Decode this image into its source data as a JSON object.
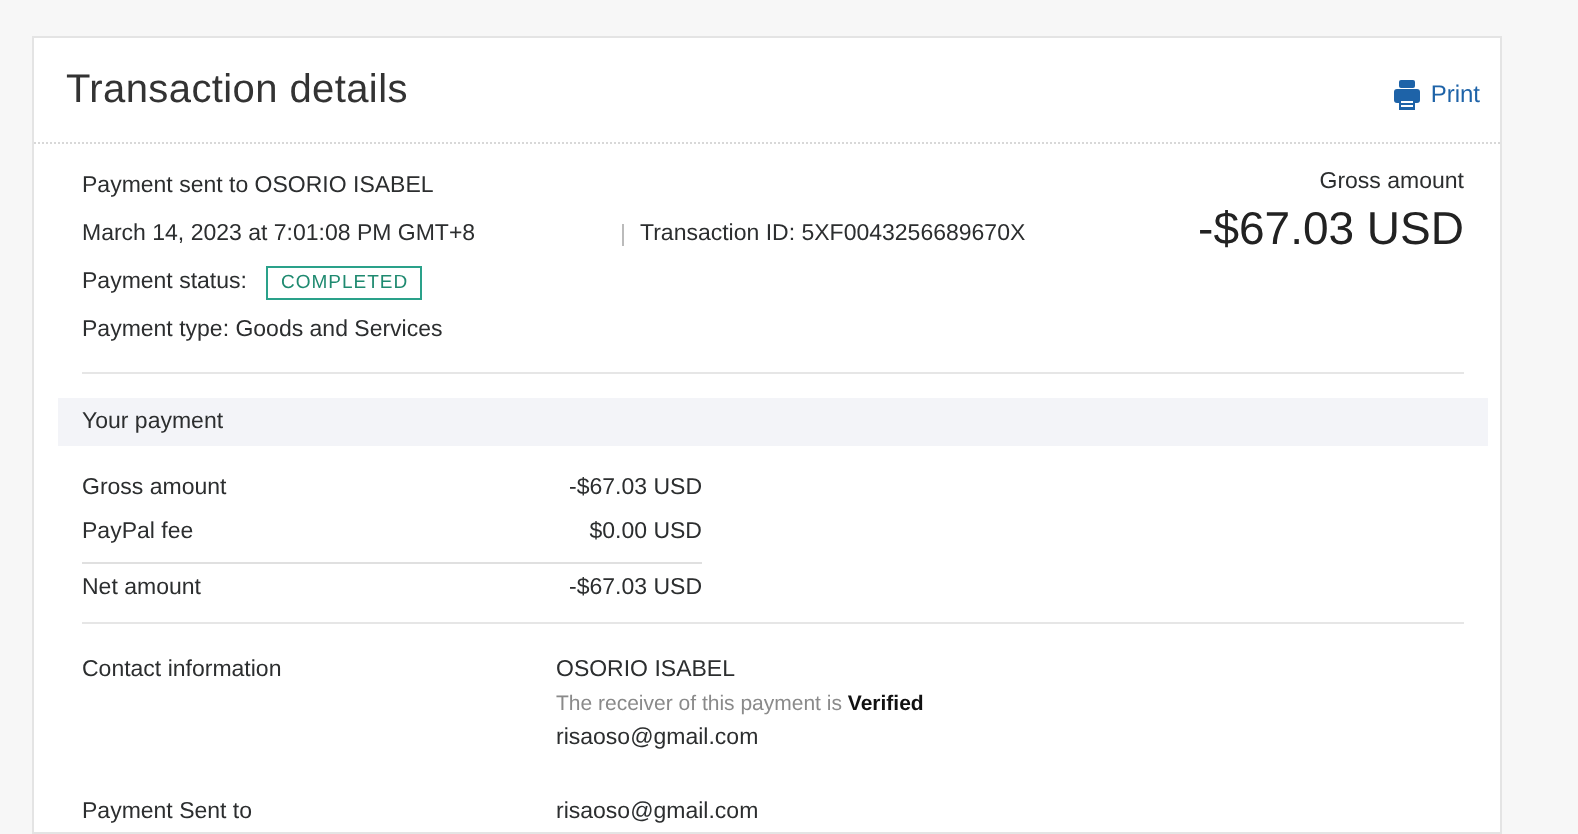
{
  "title": "Transaction details",
  "print": {
    "label": "Print"
  },
  "summary": {
    "recipient": "Payment sent to OSORIO ISABEL",
    "datetime": "March 14, 2023 at 7:01:08 PM GMT+8",
    "transaction_id": "Transaction ID: 5XF0043256689670X",
    "status_label": "Payment status:",
    "status": "COMPLETED",
    "payment_type": "Payment type: Goods and Services",
    "gross_label": "Gross amount",
    "gross_amount": "-$67.03 USD"
  },
  "your_payment": {
    "heading": "Your payment",
    "rows": [
      {
        "kind": "line",
        "label": "Gross amount",
        "value": "-$67.03 USD"
      },
      {
        "kind": "line",
        "label": "PayPal fee",
        "value": "$0.00 USD"
      },
      {
        "kind": "total",
        "label": "Net amount",
        "value": "-$67.03 USD"
      }
    ]
  },
  "details": [
    {
      "label": "Contact information",
      "lines": [
        {
          "kind": "name",
          "text": "OSORIO ISABEL"
        },
        {
          "kind": "note",
          "text": "The receiver of this payment is **Verified**"
        },
        {
          "kind": "email",
          "text": "risaoso@gmail.com"
        }
      ]
    },
    {
      "label": "Payment Sent to",
      "lines": [
        {
          "kind": "email",
          "text": "risaoso@gmail.com"
        }
      ]
    }
  ]
}
